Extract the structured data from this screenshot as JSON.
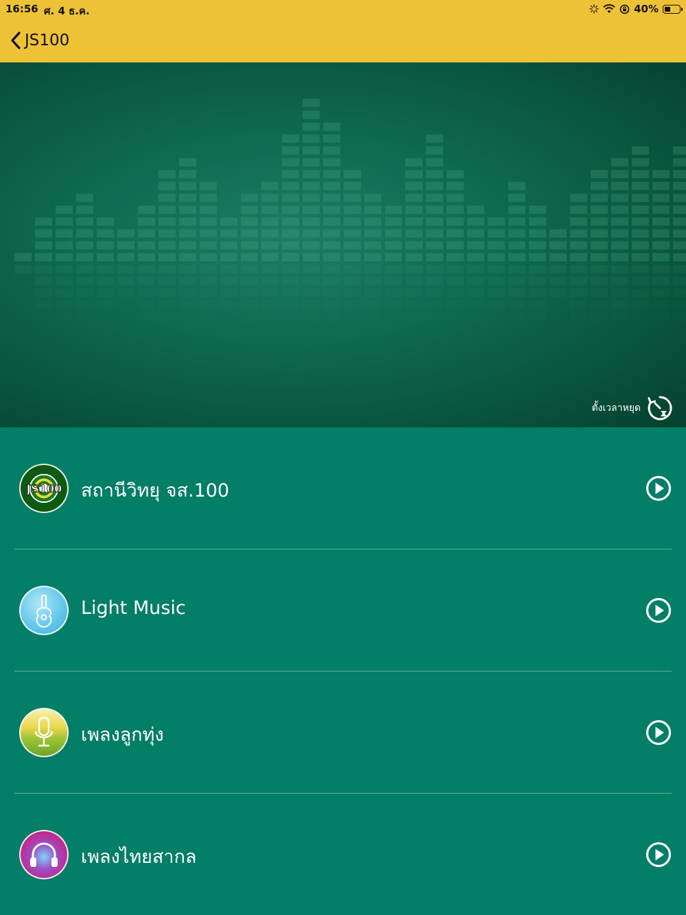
{
  "status_bar": {
    "time": "16:56",
    "date": "ศ. 4 ธ.ค.",
    "battery_percent": "40%",
    "battery_level": 0.4,
    "icons": [
      "loading-icon",
      "wifi-icon",
      "rotation-lock-icon",
      "battery-icon"
    ]
  },
  "nav": {
    "back_icon": "chevron-left-icon",
    "title": "JS100"
  },
  "hero": {
    "timer_label": "ตั้งเวลาหยุด",
    "timer_icon": "sleep-timer-icon"
  },
  "channels": [
    {
      "name": "สถานีวิทยุ จส.100",
      "icon": "js100-logo-icon",
      "action_icon": "play-icon"
    },
    {
      "name": "Light Music",
      "icon": "guitar-icon",
      "action_icon": "play-icon"
    },
    {
      "name": "เพลงลูกทุ่ง",
      "icon": "microphone-icon",
      "action_icon": "play-icon"
    },
    {
      "name": "เพลงไทยสากล",
      "icon": "headphones-icon",
      "action_icon": "play-icon"
    }
  ],
  "colors": {
    "header": "#eec236",
    "list_background": "#037e67",
    "hero_background": "#0f6a4f"
  },
  "logo_text": "JS100"
}
